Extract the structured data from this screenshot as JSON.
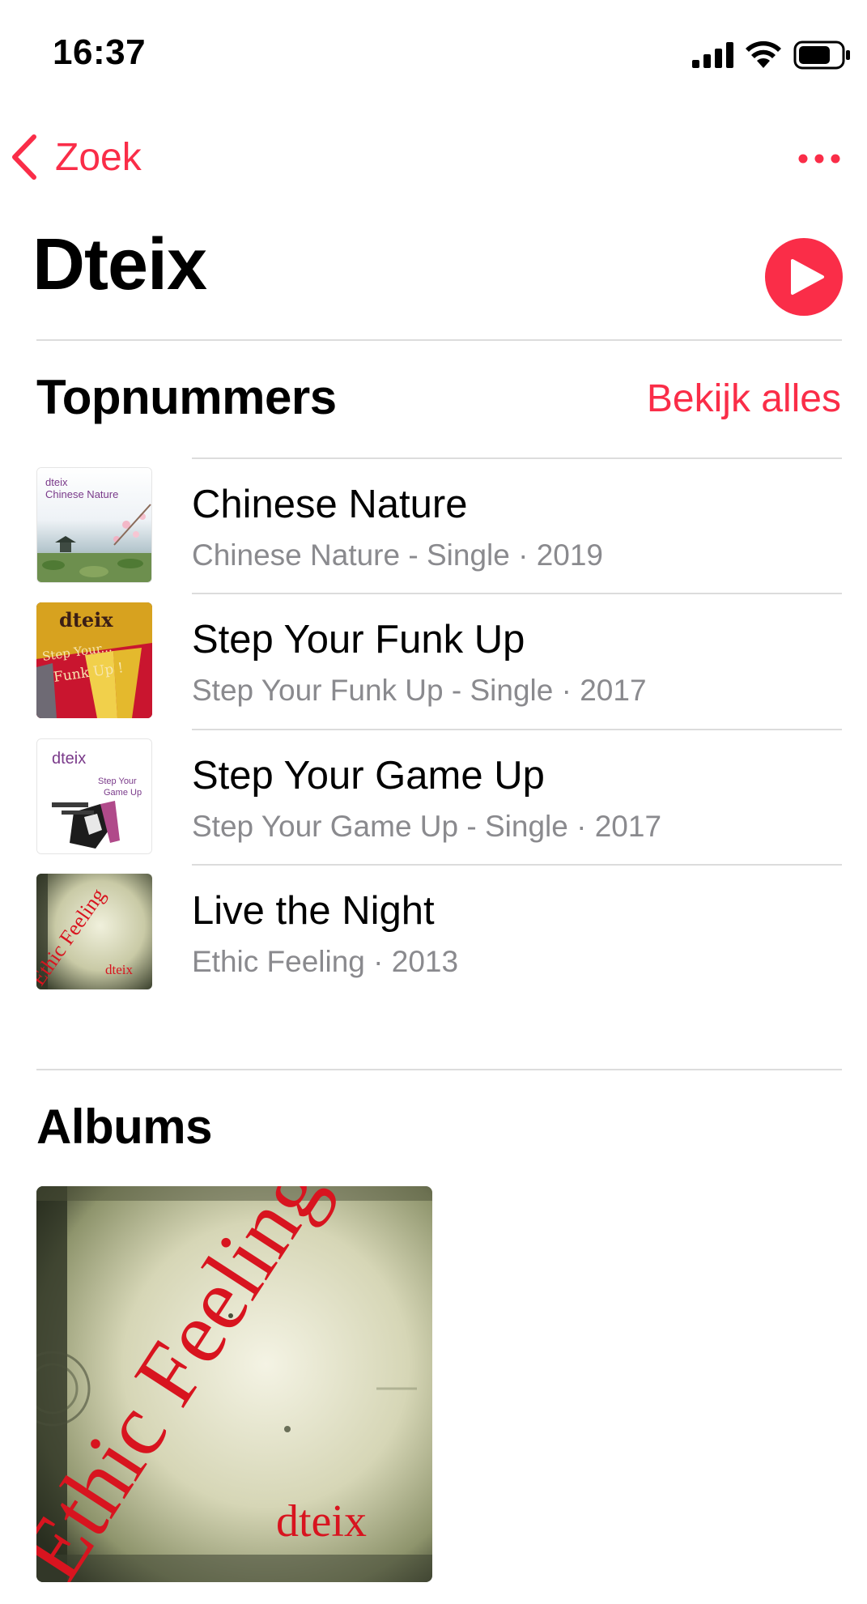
{
  "status_bar": {
    "time": "16:37"
  },
  "nav": {
    "back_label": "Zoek"
  },
  "artist": {
    "name": "Dteix"
  },
  "top_songs": {
    "heading": "Topnummers",
    "see_all": "Bekijk alles",
    "items": [
      {
        "title": "Chinese Nature",
        "subtitle": "Chinese Nature - Single · 2019",
        "art_text": [
          "dteix",
          "Chinese Nature"
        ]
      },
      {
        "title": "Step Your Funk Up",
        "subtitle": "Step Your Funk Up - Single · 2017",
        "art_text": [
          "dteix",
          "Step Your...",
          "Funk Up !"
        ]
      },
      {
        "title": "Step Your Game Up",
        "subtitle": "Step Your Game Up - Single · 2017",
        "art_text": [
          "dteix",
          "Step Your",
          "Game Up"
        ]
      },
      {
        "title": "Live the Night",
        "subtitle": "Ethic Feeling · 2013",
        "art_text": [
          "Ethic Feeling",
          "dteix"
        ]
      }
    ]
  },
  "albums": {
    "heading": "Albums",
    "items": [
      {
        "art_text": [
          "Ethic Feeling",
          "dteix"
        ]
      }
    ]
  },
  "colors": {
    "accent": "#fa2d48",
    "secondary_text": "#8a8a8e",
    "divider": "#dcdcdc"
  }
}
